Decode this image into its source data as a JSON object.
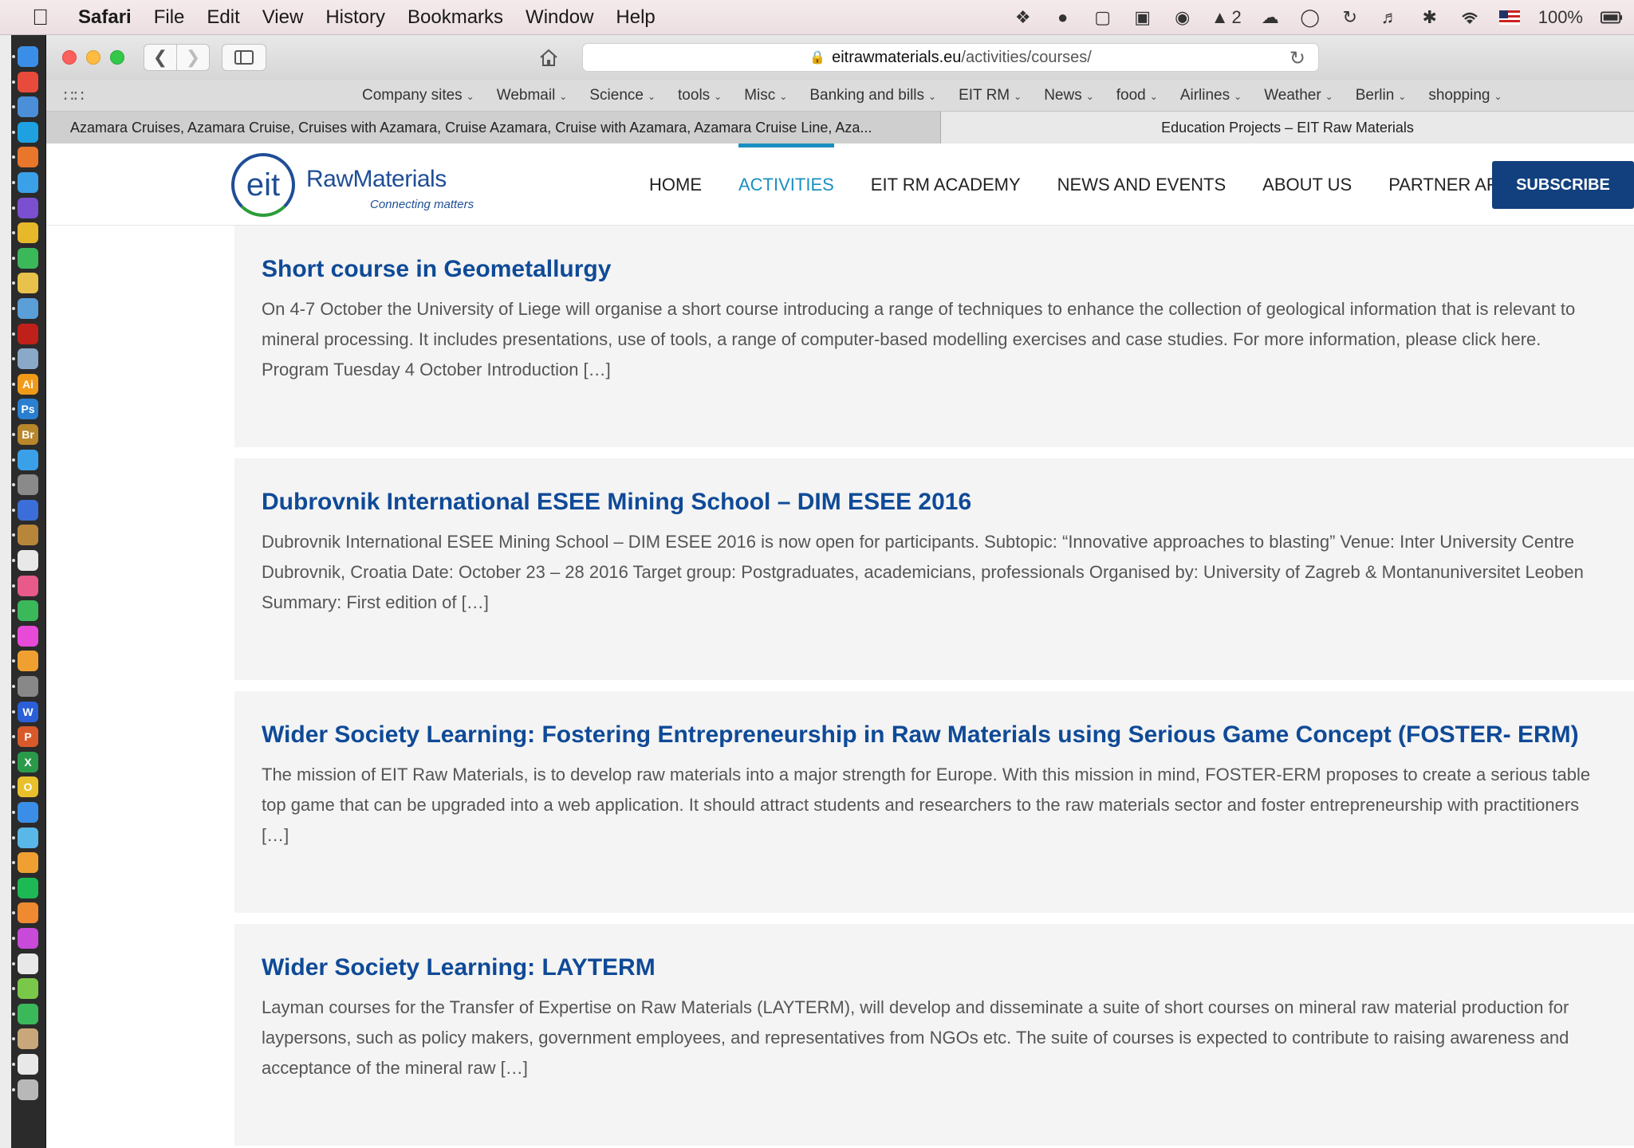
{
  "menubar": {
    "app": "Safari",
    "items": [
      "File",
      "Edit",
      "View",
      "History",
      "Bookmarks",
      "Window",
      "Help"
    ],
    "status_icons": [
      "dropbox-icon",
      "app-icon",
      "evernote-icon",
      "lock-icon",
      "globe-icon",
      "adobe-icon",
      "cloud-icon",
      "chat-icon",
      "time-machine-icon",
      "volume-icon",
      "bluetooth-icon",
      "wifi-icon",
      "flag-icon"
    ],
    "adobe_count": "2",
    "battery": "100%"
  },
  "browser": {
    "address_domain": "eitrawmaterials.eu",
    "address_path": "/activities/courses/",
    "favorites": [
      "Company sites",
      "Webmail",
      "Science",
      "tools",
      "Misc",
      "Banking and bills",
      "EIT RM",
      "News",
      "food",
      "Airlines",
      "Weather",
      "Berlin",
      "shopping"
    ],
    "tabs": [
      {
        "title": "Azamara Cruises, Azamara Cruise, Cruises with Azamara, Cruise Azamara, Cruise with Azamara, Azamara Cruise Line, Aza..."
      },
      {
        "title": "Education Projects – EIT Raw Materials"
      }
    ]
  },
  "site": {
    "logo_mark": "eit",
    "logo_name": "RawMaterials",
    "logo_tagline": "Connecting matters",
    "nav": [
      "HOME",
      "ACTIVITIES",
      "EIT RM ACADEMY",
      "NEWS AND EVENTS",
      "ABOUT US",
      "PARTNER AREA"
    ],
    "active_nav": "ACTIVITIES",
    "subscribe": "SUBSCRIBE"
  },
  "courses": [
    {
      "title": "Short course in Geometallurgy",
      "desc": "On 4-7 October the University of Liege will organise a short course introducing a range of techniques to enhance the collection of geological information that is relevant to mineral processing. It includes presentations, use of tools, a range of computer-based modelling exercises and case studies. For more information, please click here. Program Tuesday 4 October Introduction […]"
    },
    {
      "title": "Dubrovnik International ESEE Mining School – DIM ESEE 2016",
      "desc": "Dubrovnik International ESEE Mining School – DIM ESEE 2016 is now open for participants. Subtopic: “Innovative approaches to blasting” Venue: Inter University Centre Dubrovnik, Croatia Date: October 23 – 28 2016 Target group: Postgraduates, academicians, professionals Organised by: University of Zagreb & Montanuniversitet Leoben           Summary: First edition of […]"
    },
    {
      "title": "Wider Society Learning: Fostering Entrepreneurship in Raw Materials using Serious Game Concept (FOSTER- ERM)",
      "desc": "The mission of EIT Raw Materials, is to develop raw materials into a major strength for Europe. With this mission in mind, FOSTER-ERM proposes to create a serious table top game that can be upgraded into a web application. It should attract students and researchers to the raw materials sector and foster entrepreneurship with practitioners […]"
    },
    {
      "title": "Wider Society Learning: LAYTERM",
      "desc": "Layman courses for the Transfer of Expertise on Raw Materials (LAYTERM), will develop and disseminate a suite of short courses on mineral raw material production for laypersons, such as policy makers, government employees, and representatives from NGOs etc. The suite of courses is expected to contribute to raising awareness and acceptance of the mineral raw […]"
    }
  ],
  "dock_icons": [
    {
      "name": "finder-icon",
      "color": "#3b8ee8"
    },
    {
      "name": "calendar-icon",
      "color": "#e84a3b"
    },
    {
      "name": "preview-icon",
      "color": "#4a8fd8"
    },
    {
      "name": "skype-icon",
      "color": "#1da1e0"
    },
    {
      "name": "firefox-icon",
      "color": "#e8762b"
    },
    {
      "name": "safari-icon",
      "color": "#3aa0e8"
    },
    {
      "name": "app-icon",
      "color": "#7a4fd0"
    },
    {
      "name": "chrome-icon",
      "color": "#e8b82b"
    },
    {
      "name": "globe-icon",
      "color": "#3bb85a"
    },
    {
      "name": "notes-icon",
      "color": "#e8c24a"
    },
    {
      "name": "network-icon",
      "color": "#5a9fd8"
    },
    {
      "name": "acrobat-icon",
      "color": "#c0201a"
    },
    {
      "name": "mail-icon",
      "color": "#8aa8c8"
    },
    {
      "name": "illustrator-icon",
      "color": "#f19a1a",
      "label": "Ai"
    },
    {
      "name": "photoshop-icon",
      "color": "#2a7fd0",
      "label": "Ps"
    },
    {
      "name": "bridge-icon",
      "color": "#b8862b",
      "label": "Br"
    },
    {
      "name": "app-icon",
      "color": "#3aa0e8"
    },
    {
      "name": "rocket-icon",
      "color": "#8a8a8a"
    },
    {
      "name": "calculator-icon",
      "color": "#3b6ed8"
    },
    {
      "name": "contacts-icon",
      "color": "#b8863b"
    },
    {
      "name": "textedit-icon",
      "color": "#e8e8e8"
    },
    {
      "name": "photos-icon",
      "color": "#e85a8a"
    },
    {
      "name": "facetime-icon",
      "color": "#3bb85a"
    },
    {
      "name": "itunes-icon",
      "color": "#e84ad8"
    },
    {
      "name": "ibooks-icon",
      "color": "#f0a030"
    },
    {
      "name": "settings-icon",
      "color": "#888888"
    },
    {
      "name": "word-icon",
      "color": "#2b5fd8",
      "label": "W"
    },
    {
      "name": "powerpoint-icon",
      "color": "#d85a2b",
      "label": "P"
    },
    {
      "name": "excel-icon",
      "color": "#2a9a4a",
      "label": "X"
    },
    {
      "name": "outlook-icon",
      "color": "#e8c02b",
      "label": "O"
    },
    {
      "name": "app-icon",
      "color": "#3b8ee8"
    },
    {
      "name": "app-icon",
      "color": "#5ab8e8"
    },
    {
      "name": "app-icon",
      "color": "#f0a030"
    },
    {
      "name": "spotify-icon",
      "color": "#1db954"
    },
    {
      "name": "app-icon",
      "color": "#f08a30"
    },
    {
      "name": "app-icon",
      "color": "#c84ad8"
    },
    {
      "name": "app-icon",
      "color": "#e8e8e8"
    },
    {
      "name": "app-icon",
      "color": "#7ac84a"
    },
    {
      "name": "globe-icon",
      "color": "#3bb85a"
    },
    {
      "name": "app-icon",
      "color": "#c8a87a"
    },
    {
      "name": "document-icon",
      "color": "#e8e8e8"
    },
    {
      "name": "trash-icon",
      "color": "#b8b8b8"
    }
  ]
}
